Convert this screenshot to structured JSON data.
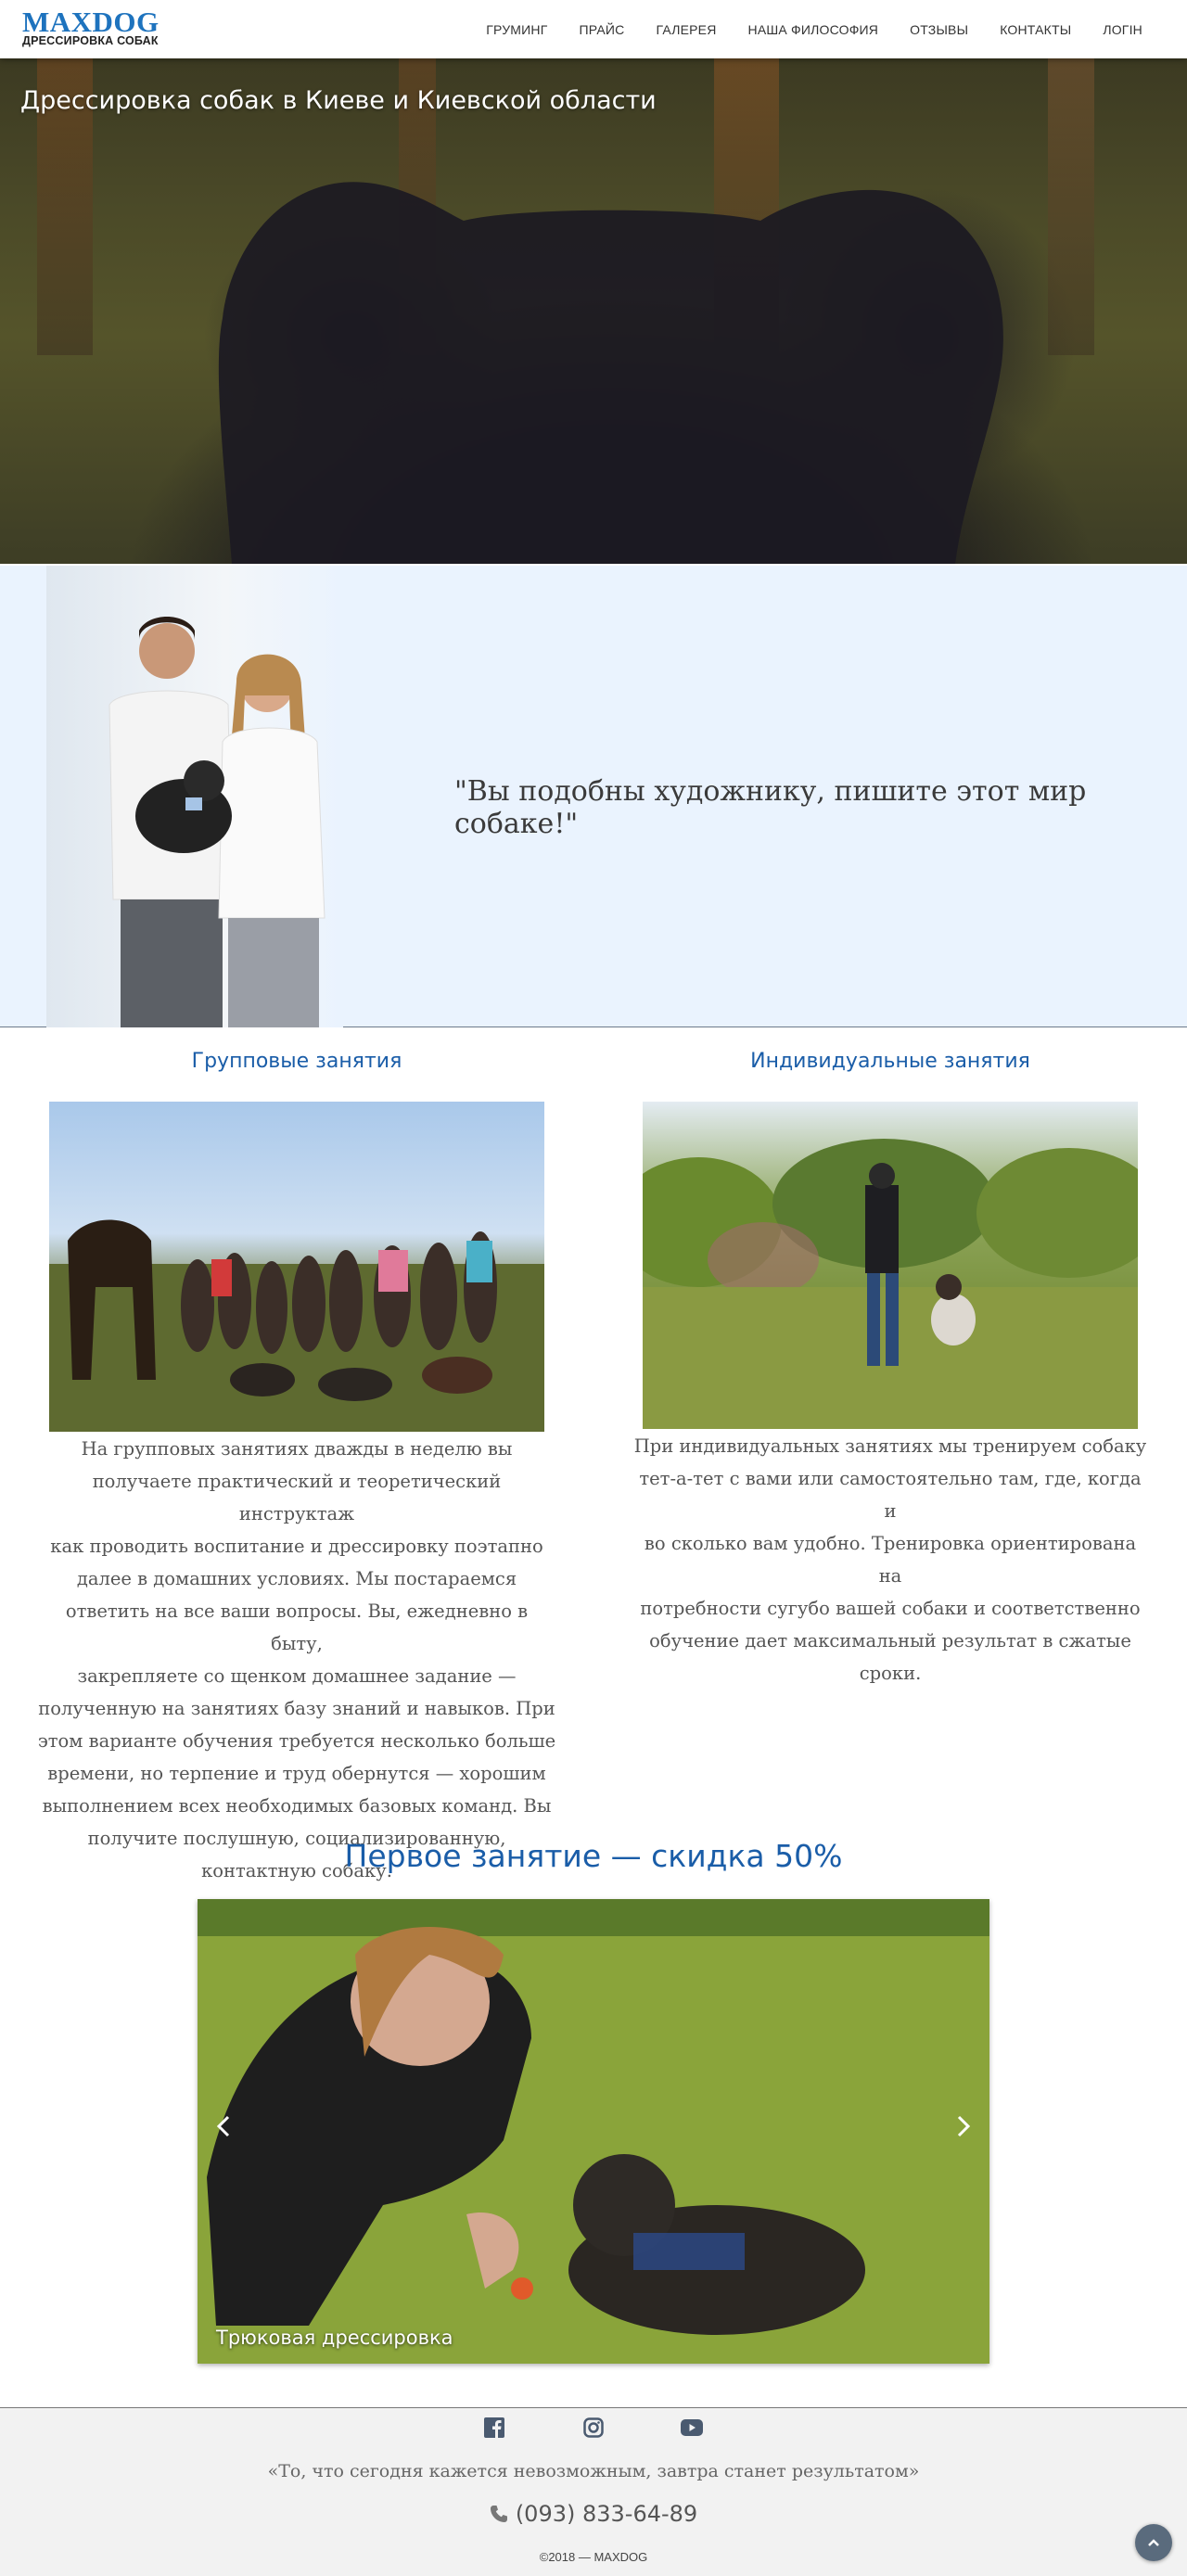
{
  "brand": {
    "name": "MAXDOG",
    "tagline": "ДРЕССИРОВКА СОБАК",
    "color": "#1e73be"
  },
  "nav": {
    "items": [
      {
        "label": "ГРУМИНГ"
      },
      {
        "label": "ПРАЙС"
      },
      {
        "label": "ГАЛЕРЕЯ"
      },
      {
        "label": "НАША ФИЛОСОФИЯ"
      },
      {
        "label": "ОТЗЫВЫ"
      },
      {
        "label": "КОНТАКТЫ"
      },
      {
        "label": "ЛОГІН"
      }
    ]
  },
  "hero": {
    "title": "Дрессировка собак в Киеве и Киевской области"
  },
  "quote": {
    "text": "\"Вы подобны художнику, пишите этот мир собаке!\"",
    "background": "#eaf3fe"
  },
  "classes": {
    "group": {
      "title": "Групповые занятия",
      "lines": [
        "На групповых занятиях дважды в неделю вы",
        "получаете практический и теоретический инструктаж",
        "как проводить воспитание и дрессировку поэтапно",
        "далее в домашних условиях. Мы постараемся",
        "ответить на все ваши вопросы. Вы, ежедневно в быту,",
        "закрепляете со щенком домашнее задание —",
        "полученную на занятиях базу знаний и навыков. При",
        "этом варианте обучения требуется несколько больше",
        "времени, но терпение и труд обернутся — хорошим",
        "выполнением всех необходимых базовых команд. Вы",
        "получите послушную, социализированную,",
        "контактную собаку."
      ]
    },
    "individual": {
      "title": "Индивидуальные занятия",
      "lines": [
        "При индивидуальных занятиях мы тренируем собаку",
        "тет-а-тет с вами или самостоятельно там, где, когда и",
        "во сколько вам удобно. Тренировка ориентирована на",
        "потребности сугубо вашей собаки и соответственно",
        "обучение дает максимальный результат в сжатые",
        "сроки."
      ]
    },
    "title_color": "#1a5da8"
  },
  "offer": {
    "title": "Первое занятие — скидка 50%",
    "slide_caption": "Трюковая дрессировка",
    "prev_icon": "chevron-left-icon",
    "next_icon": "chevron-right-icon"
  },
  "footer": {
    "social": [
      "facebook-icon",
      "instagram-icon",
      "youtube-icon"
    ],
    "quote": "«То, что сегодня кажется невозможным, завтра станет результатом»",
    "phone": "(093) 833-64-89",
    "copyright": "©2018 — MAXDOG",
    "to_top_icon": "chevron-up-icon"
  }
}
